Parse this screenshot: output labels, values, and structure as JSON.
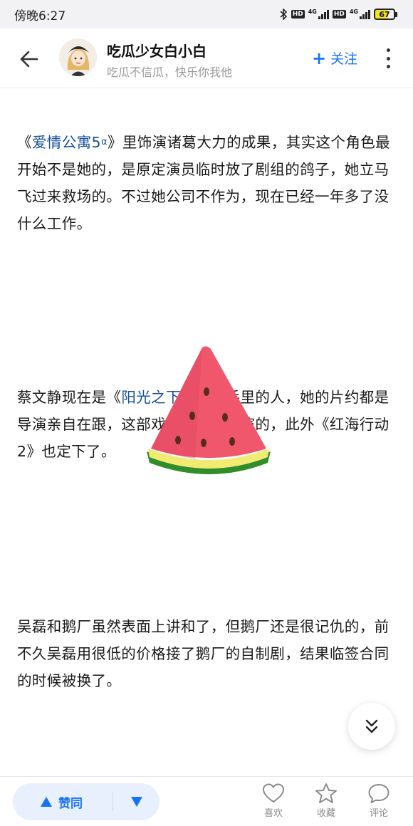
{
  "status": {
    "time": "傍晚6:27",
    "network_1": "4G",
    "network_2": "4G",
    "hd": "HD",
    "battery": "67"
  },
  "header": {
    "author_name": "吃瓜少女白小白",
    "author_bio": "吃瓜不信瓜，快乐你我他",
    "follow_label": "关注"
  },
  "article": {
    "para1": {
      "open": "《",
      "link": "爱情公寓5",
      "rest": "》里饰演诸葛大力的成果，其实这个角色最开始不是她的，是原定演员临时放了剧组的鸽子，她立马飞过来救场的。不过她公司不作为，现在已经一年多了没什么工作。"
    },
    "para2": {
      "pre": "蔡文静现在是《",
      "link": "阳光之下",
      "rest": "》导演手里的人，她的片约都是导演亲自在跟，这部戏也是这个导演的，此外《红海行动2》也定下了。"
    },
    "para3": "吴磊和鹅厂虽然表面上讲和了，但鹅厂还是很记仇的，前不久吴磊用很低的价格接了鹅厂的自制剧，结果临签合同的时候被换了。"
  },
  "bottom": {
    "upvote_label": "赞同",
    "like_label": "喜欢",
    "collect_label": "收藏",
    "comment_label": "评论"
  },
  "colors": {
    "accent": "#1772f6",
    "link": "#175199",
    "muted": "#999999"
  }
}
